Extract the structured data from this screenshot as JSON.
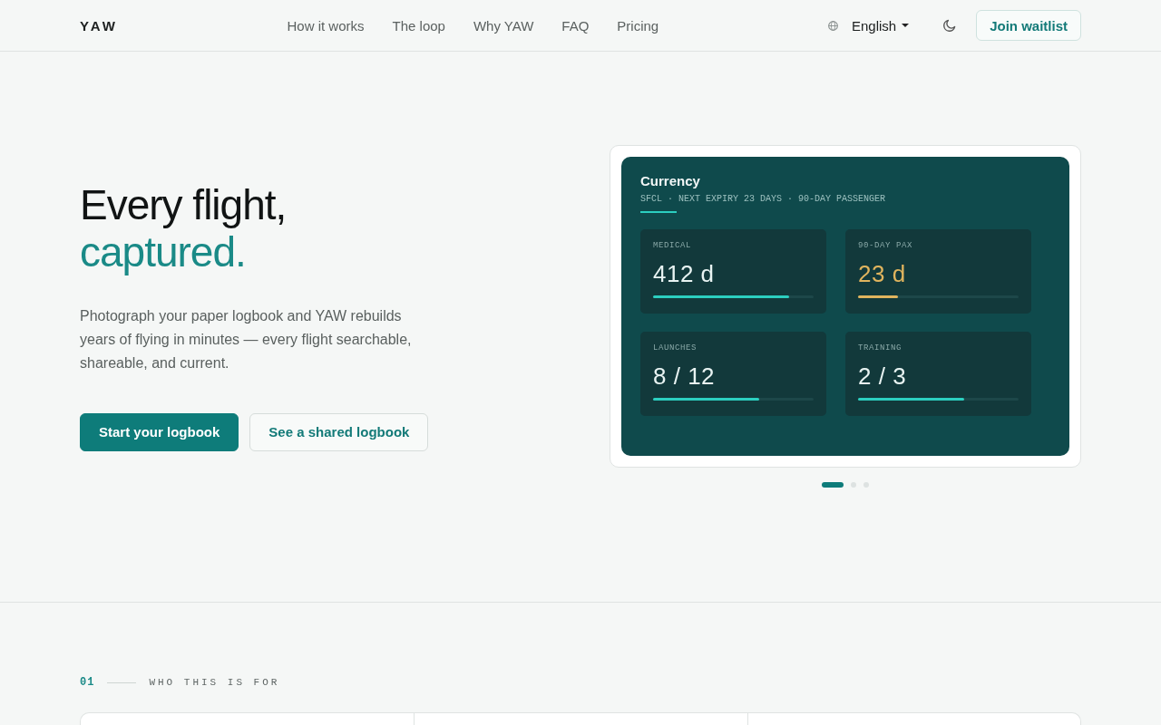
{
  "header": {
    "logo": "YAW",
    "nav": [
      "How it works",
      "The loop",
      "Why YAW",
      "FAQ",
      "Pricing"
    ],
    "language": "English",
    "cta": "Join waitlist"
  },
  "hero": {
    "title_line_1": "Every flight,",
    "title_line_2": "captured.",
    "description": "Photograph your paper logbook and YAW rebuilds years of flying in minutes — every flight searchable, shareable, and current.",
    "buttons": [
      {
        "label": "Start your logbook",
        "kind": "primary"
      },
      {
        "label": "See a shared logbook",
        "kind": "secondary"
      }
    ]
  },
  "preview": {
    "title": "Currency",
    "subtitle": "SFCL · NEXT EXPIRY 23 DAYS · 90-DAY PASSENGER",
    "metrics": [
      {
        "label": "MEDICAL",
        "value": "412 d",
        "level": 0.85,
        "color": "#2ccfc0"
      },
      {
        "label": "90-DAY PAX",
        "value": "23 d",
        "level": 0.25,
        "color": "#e0b45e"
      },
      {
        "label": "LAUNCHES",
        "value": "8 / 12",
        "level": 0.66,
        "color": "#2ccfc0"
      },
      {
        "label": "TRAINING",
        "value": "2 / 3",
        "level": 0.66,
        "color": "#2ccfc0"
      }
    ],
    "slides": [
      {
        "selected": true
      },
      {
        "selected": false
      },
      {
        "selected": false
      }
    ]
  },
  "section": {
    "number": "01",
    "title": "WHO THIS IS FOR"
  }
}
